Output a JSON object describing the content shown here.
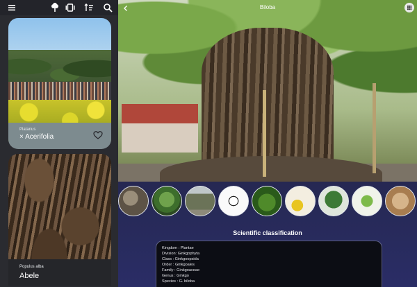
{
  "toolbar": {
    "icons": [
      "menu-icon",
      "tree-icon",
      "view-toggle-icon",
      "sort-icon",
      "search-icon"
    ]
  },
  "cards": [
    {
      "genus": "Platanus",
      "species": "× Acerifolia",
      "favorite_icon": "heart-icon"
    },
    {
      "genus": "Populus alba",
      "species": "Abele"
    }
  ],
  "detail": {
    "title": "Biloba",
    "back_icon": "chevron-left-icon",
    "grid_icon": "grid-icon",
    "thumbnails": [
      "bark-thumb",
      "leaves-thumb",
      "tree-silhouette-thumb",
      "leaf-drawing-thumb",
      "leaf-closeup-thumb",
      "seeds-thumb",
      "tree-thumb",
      "leaf-twig-thumb",
      "wood-thumb"
    ],
    "section_title": "Scientific classification",
    "classification": [
      "Kingdom : Plantae",
      "Division: Ginkgophyta",
      "Class : Ginkgoopsida",
      "Order : Ginkgoales",
      "Family : Ginkgoaceae",
      "Genus : Ginkgo",
      "Species : G. biloba"
    ]
  }
}
